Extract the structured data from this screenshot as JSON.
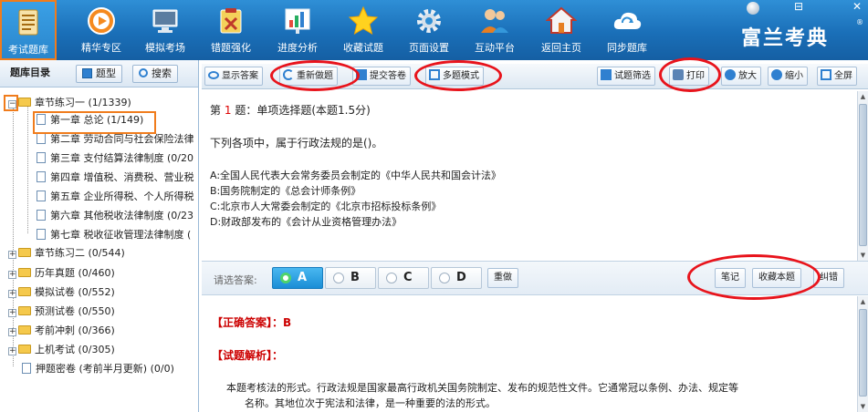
{
  "window": {
    "minimize": "⊟",
    "close": "✕"
  },
  "brand": {
    "name": "富兰考典",
    "registered": "®"
  },
  "topbar": {
    "items": [
      {
        "label": "考试题库",
        "icon": "question-bank-icon"
      },
      {
        "label": "精华专区",
        "icon": "play-circle-icon"
      },
      {
        "label": "模拟考场",
        "icon": "monitor-icon"
      },
      {
        "label": "错题强化",
        "icon": "wrong-question-icon"
      },
      {
        "label": "进度分析",
        "icon": "progress-chart-icon"
      },
      {
        "label": "收藏试题",
        "icon": "star-icon"
      },
      {
        "label": "页面设置",
        "icon": "gear-icon"
      },
      {
        "label": "互动平台",
        "icon": "users-icon"
      },
      {
        "label": "返回主页",
        "icon": "home-icon"
      },
      {
        "label": "同步题库",
        "icon": "cloud-sync-icon"
      }
    ]
  },
  "left": {
    "tabs": [
      "题库目录",
      "题型",
      "搜索"
    ],
    "tree": [
      {
        "label": "章节练习一 (1/1339)",
        "level": 0
      },
      {
        "label": "第一章 总论 (1/149)",
        "level": 1
      },
      {
        "label": "第二章 劳动合同与社会保险法律",
        "level": 1
      },
      {
        "label": "第三章 支付结算法律制度 (0/20",
        "level": 1
      },
      {
        "label": "第四章 增值税、消费税、营业税",
        "level": 1
      },
      {
        "label": "第五章 企业所得税、个人所得税",
        "level": 1
      },
      {
        "label": "第六章 其他税收法律制度 (0/23",
        "level": 1
      },
      {
        "label": "第七章 税收征收管理法律制度 (",
        "level": 1
      },
      {
        "label": "章节练习二 (0/544)",
        "level": 0
      },
      {
        "label": "历年真题 (0/460)",
        "level": 0
      },
      {
        "label": "模拟试卷 (0/552)",
        "level": 0
      },
      {
        "label": "预测试卷 (0/550)",
        "level": 0
      },
      {
        "label": "考前冲刺 (0/366)",
        "level": 0
      },
      {
        "label": "上机考试 (0/305)",
        "level": 0
      },
      {
        "label": "押题密卷 (考前半月更新) (0/0)",
        "level": 0
      }
    ]
  },
  "rightbar": {
    "show_answer": "显示答案",
    "redo": "重新做题",
    "submit": "提交答卷",
    "multi_mode": "多题模式",
    "filter": "试题筛选",
    "print": "打印",
    "zoom_in": "放大",
    "zoom_out": "缩小",
    "fullscreen": "全屏"
  },
  "question": {
    "prefix": "第",
    "number": "1",
    "suffix": "题：单项选择题(本题1.5分)",
    "stem": "下列各项中，属于行政法规的是()。",
    "options": [
      "A:全国人民代表大会常务委员会制定的《中华人民共和国会计法》",
      "B:国务院制定的《总会计师条例》",
      "C:北京市人大常委会制定的《北京市招标投标条例》",
      "D:财政部发布的《会计从业资格管理办法》"
    ]
  },
  "answerbar": {
    "label": "请选答案:",
    "choices": [
      "A",
      "B",
      "C",
      "D"
    ],
    "selected": "A",
    "reset": "重做",
    "notes": "笔记",
    "favorite": "收藏本题",
    "report": "纠错"
  },
  "answer": {
    "correct_label": "【正确答案】：",
    "correct_value": "B",
    "analysis_label": "【试题解析】：",
    "analysis_line1": "本题考核法的形式。行政法规是国家最高行政机关国务院制定、发布的规范性文件。它通常冠以条例、办法、规定等",
    "analysis_line2": "名称。其地位次于宪法和法律，是一种重要的法的形式。"
  },
  "colors": {
    "accent": "#1a6fb8",
    "highlight": "#f07c1c",
    "annotation": "#e8141c"
  }
}
